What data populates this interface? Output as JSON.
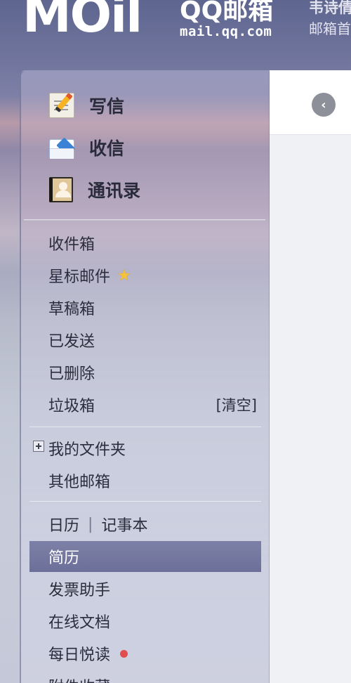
{
  "header": {
    "logo_text": "MOil",
    "brand_name": "QQ邮箱",
    "brand_domain": "mail.qq.com",
    "user_name": "韦诗倩",
    "user_sub": "邮箱首页"
  },
  "quick_actions": [
    {
      "label": "写信",
      "icon": "compose-icon"
    },
    {
      "label": "收信",
      "icon": "inbox-envelope-icon"
    },
    {
      "label": "通讯录",
      "icon": "contacts-icon"
    }
  ],
  "folders": [
    {
      "label": "收件箱"
    },
    {
      "label": "星标邮件",
      "badge": "★"
    },
    {
      "label": "草稿箱"
    },
    {
      "label": "已发送"
    },
    {
      "label": "已删除"
    },
    {
      "label": "垃圾箱",
      "action": "[清空]"
    }
  ],
  "folder_group": [
    {
      "label": "我的文件夹",
      "expand": "+"
    },
    {
      "label": "其他邮箱"
    }
  ],
  "apps": {
    "calendar": "日历",
    "separator": "|",
    "notebook": "记事本",
    "items": [
      {
        "label": "简历",
        "active": true
      },
      {
        "label": "发票助手"
      },
      {
        "label": "在线文档"
      },
      {
        "label": "每日悦读",
        "unread_dot": true
      },
      {
        "label": "附件收藏"
      }
    ]
  },
  "main": {
    "collapse_glyph": "‹"
  },
  "colors": {
    "active_item": "#6c6f98",
    "unread_dot": "#e24d4f",
    "star": "#f5c23b"
  }
}
